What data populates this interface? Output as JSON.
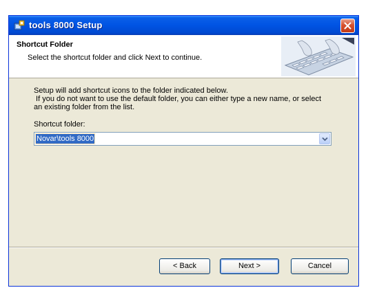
{
  "window": {
    "title": "tools 8000 Setup"
  },
  "header": {
    "title": "Shortcut Folder",
    "subtitle": "Select the shortcut folder and click Next to continue."
  },
  "content": {
    "description_lines": [
      "Setup will add shortcut icons to the folder indicated below.",
      " If you do not want to use the default folder, you can either type a new name, or select",
      "an existing folder from the list."
    ],
    "field_label": "Shortcut folder:",
    "folder_value": "Novar\\tools 8000"
  },
  "buttons": {
    "back": "< Back",
    "next": "Next >",
    "cancel": "Cancel"
  },
  "icons": {
    "app": "setup-icon",
    "close": "close-icon",
    "dropdown": "chevron-down-icon"
  }
}
